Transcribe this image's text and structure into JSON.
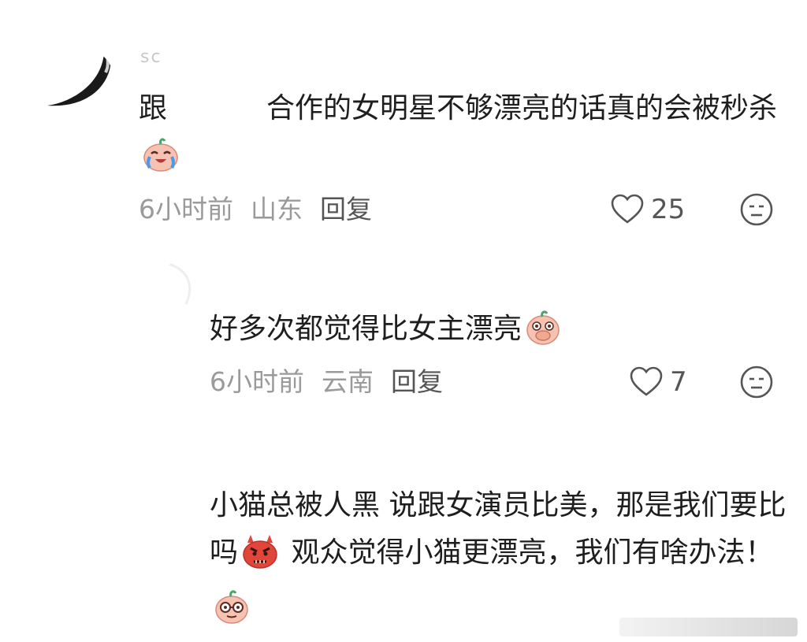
{
  "comments": [
    {
      "username": "sc",
      "text_before": "跟",
      "text_after": "合作的女明星不够漂亮的话真的会被秒杀",
      "emoji": "crying-laugh-emoji",
      "time": "6小时前",
      "location": "山东",
      "reply_label": "回复",
      "likes": "25"
    },
    {
      "username": "",
      "text": "好多次都觉得比女主漂亮",
      "emoji": "hand-over-mouth-emoji",
      "time": "6小时前",
      "location": "云南",
      "reply_label": "回复",
      "likes": "7"
    },
    {
      "username": "",
      "text_part1": "小猫总被人黑 说跟女演员比美，那是我们要比吗",
      "emoji_1": "angry-devil-emoji",
      "text_part2": " 观众觉得小猫更漂亮，我们有啥办法！",
      "emoji_2": "glasses-emoji"
    }
  ],
  "colors": {
    "text": "#1e1e1e",
    "meta": "#9a9a9a",
    "emoji_skin": "#f4b8a8",
    "angry_red": "#e0463a"
  }
}
